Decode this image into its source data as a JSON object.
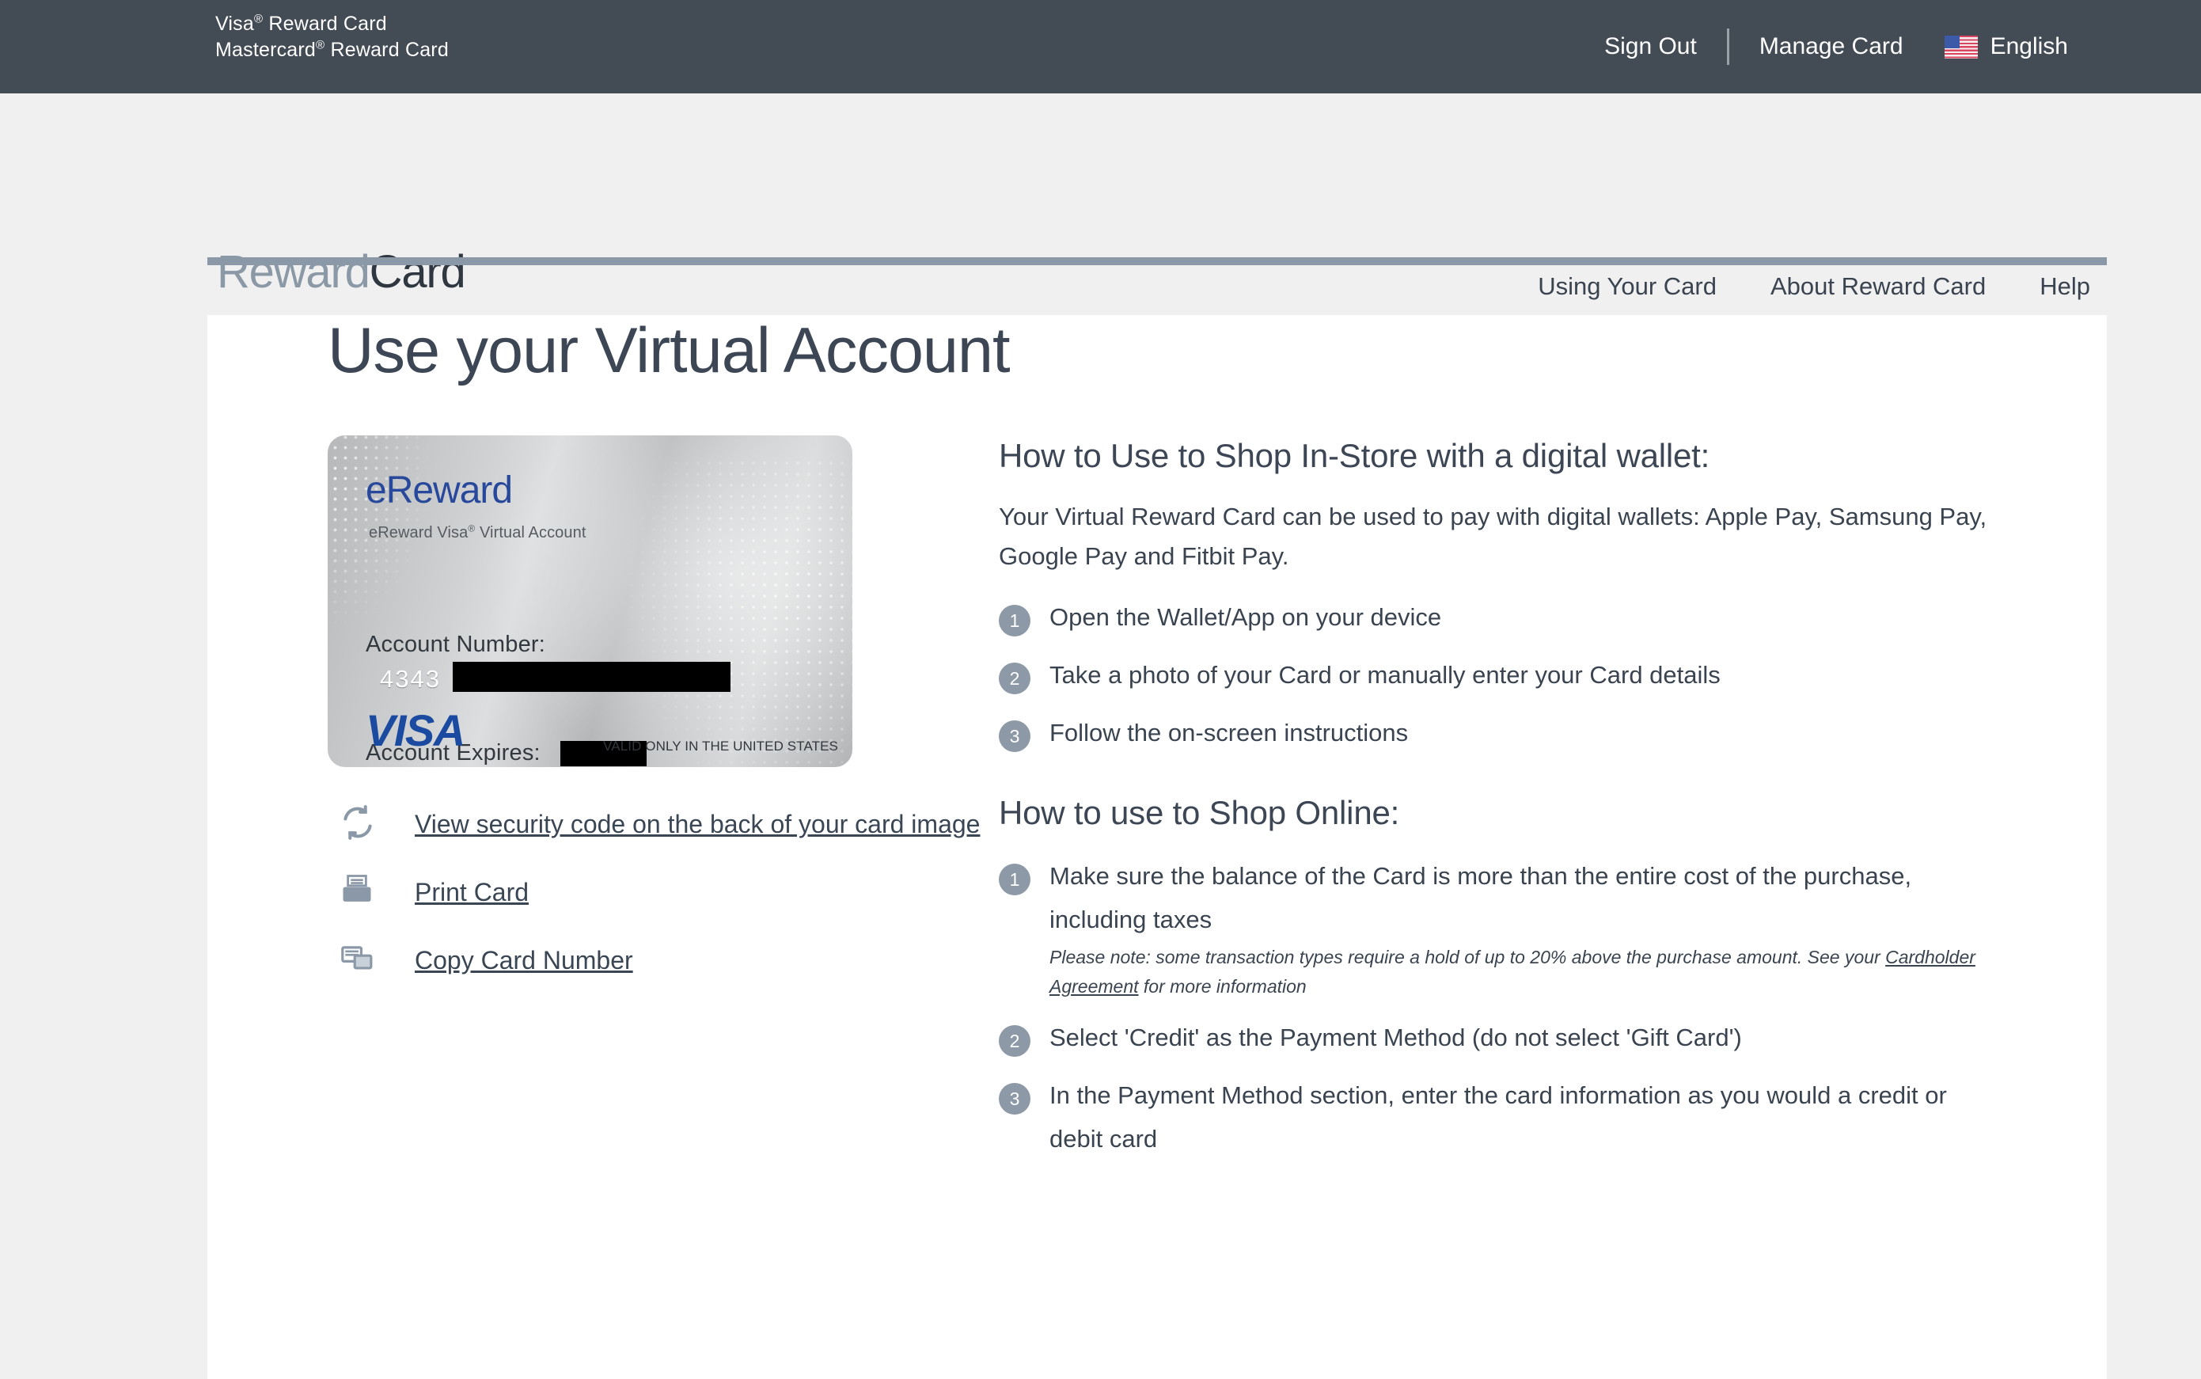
{
  "topbar": {
    "brand_line1_pre": "Visa",
    "brand_line1_sup": "®",
    "brand_line1_post": " Reward Card",
    "brand_line2_pre": "Mastercard",
    "brand_line2_sup": "®",
    "brand_line2_post": " Reward Card",
    "sign_out": "Sign Out",
    "manage_card": "Manage Card",
    "language": "English",
    "flag_icon": "us-flag-icon"
  },
  "header": {
    "logo_word1": "Reward",
    "logo_word2": "Card",
    "nav": [
      {
        "label": "Using Your Card"
      },
      {
        "label": "About Reward Card"
      },
      {
        "label": "Help"
      }
    ]
  },
  "page": {
    "title": "Use your Virtual Account"
  },
  "card": {
    "brand": "eReward",
    "subtitle_pre": "eReward Visa",
    "subtitle_sup": "®",
    "subtitle_post": " Virtual Account",
    "account_number_label": "Account Number:",
    "account_number_value": "4343",
    "account_expires_label": "Account Expires:",
    "account_expires_value": "",
    "network_logo": "VISA",
    "valid_text": "VALID ONLY IN THE UNITED STATES"
  },
  "actions": [
    {
      "icon": "flip-card-icon",
      "label": "View security code on the back of your card image"
    },
    {
      "icon": "printer-icon",
      "label": "Print Card"
    },
    {
      "icon": "copy-icon",
      "label": "Copy Card Number"
    }
  ],
  "instore": {
    "heading": "How to Use to Shop In-Store with a digital wallet:",
    "intro": "Your Virtual Reward Card can be used to pay with digital wallets: Apple Pay, Samsung Pay, Google Pay and Fitbit Pay.",
    "steps": [
      {
        "num": "1",
        "text": "Open the Wallet/App on your device"
      },
      {
        "num": "2",
        "text": "Take a photo of your Card or manually enter your Card details"
      },
      {
        "num": "3",
        "text": "Follow the on-screen instructions"
      }
    ]
  },
  "online": {
    "heading": "How to use to Shop Online:",
    "steps": [
      {
        "num": "1",
        "text": "Make sure the balance of the Card is more than the entire cost of the purchase, including taxes",
        "note_pre": "Please note: some transaction types require a hold of up to 20% above the purchase amount. See your ",
        "note_link": "Cardholder Agreement",
        "note_post": " for more information"
      },
      {
        "num": "2",
        "text": "Select 'Credit' as the Payment Method (do not select 'Gift Card')"
      },
      {
        "num": "3",
        "text": "In the Payment Method section, enter the card information as you would a credit or debit card"
      }
    ]
  },
  "colors": {
    "topbar_bg": "#434b55",
    "accent_gray_blue": "#8b98a8",
    "text_dark": "#3a4450",
    "visa_blue": "#1a4ba0",
    "ereward_blue": "#27489b"
  }
}
